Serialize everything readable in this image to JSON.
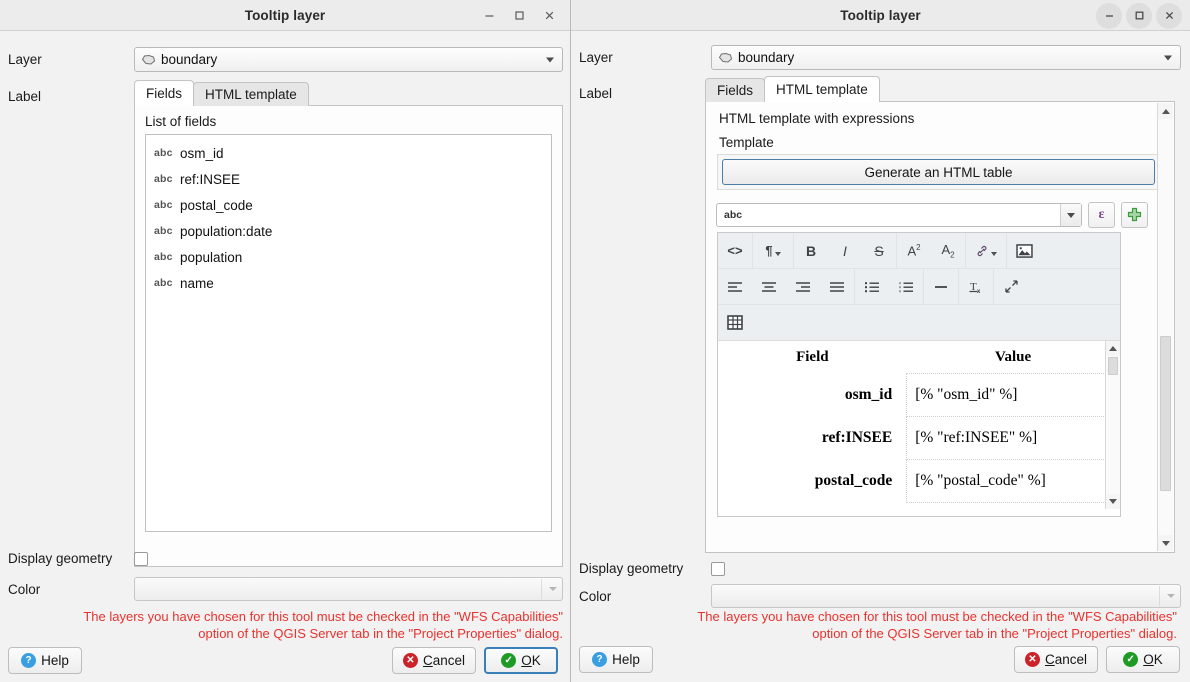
{
  "left_window": {
    "title": "Tooltip layer",
    "window_controls": [
      "minimize",
      "maximize",
      "close"
    ],
    "layer_label": "Layer",
    "layer_value": "boundary",
    "layer_icon": "polygon-layer-icon",
    "label_label": "Label",
    "tabs": [
      {
        "label": "Fields",
        "active": true
      },
      {
        "label": "HTML template",
        "active": false
      }
    ],
    "list_title": "List of fields",
    "field_type_badge": "abc",
    "fields": [
      "osm_id",
      "ref:INSEE",
      "postal_code",
      "population:date",
      "population",
      "name"
    ],
    "display_geometry_label": "Display geometry",
    "display_geometry_checked": false,
    "color_label": "Color",
    "color_value": "",
    "warning_line1": "The layers you have chosen for this tool must be checked in the \"WFS Capabilities\"",
    "warning_line2": "option of the QGIS Server tab in the \"Project Properties\" dialog.",
    "help_label": "Help",
    "cancel_label": "Cancel",
    "ok_label": "OK"
  },
  "right_window": {
    "title": "Tooltip layer",
    "window_controls": [
      "minimize",
      "maximize",
      "close"
    ],
    "layer_label": "Layer",
    "layer_value": "boundary",
    "layer_icon": "polygon-layer-icon",
    "label_label": "Label",
    "tabs": [
      {
        "label": "Fields",
        "active": false
      },
      {
        "label": "HTML template",
        "active": true
      }
    ],
    "panel_title": "HTML template with expressions",
    "template_label": "Template",
    "generate_button": "Generate an HTML table",
    "expression_combo_value": "abc",
    "expression_button": "ε",
    "add_button": "+",
    "toolbar_rows": [
      [
        {
          "name": "source-code-icon",
          "glyph": "<>",
          "has_caret": false
        },
        {
          "name": "paragraph-format-icon",
          "glyph": "¶",
          "has_caret": true
        },
        {
          "name": "bold-icon",
          "glyph": "B",
          "has_caret": false
        },
        {
          "name": "italic-icon",
          "glyph": "I",
          "has_caret": false
        },
        {
          "name": "strikethrough-icon",
          "glyph": "S",
          "has_caret": false
        },
        {
          "name": "superscript-icon",
          "glyph": "A²",
          "has_caret": false
        },
        {
          "name": "subscript-icon",
          "glyph": "A₂",
          "has_caret": false
        },
        {
          "name": "link-icon",
          "glyph": "🔗",
          "has_caret": true
        },
        {
          "name": "insert-image-icon",
          "glyph": "image",
          "has_caret": false
        }
      ],
      [
        {
          "name": "align-left-icon",
          "glyph": "align-left",
          "has_caret": false
        },
        {
          "name": "align-center-icon",
          "glyph": "align-center",
          "has_caret": false
        },
        {
          "name": "align-right-icon",
          "glyph": "align-right",
          "has_caret": false
        },
        {
          "name": "align-justify-icon",
          "glyph": "align-justify",
          "has_caret": false
        },
        {
          "name": "bullet-list-icon",
          "glyph": "bullet-list",
          "has_caret": false
        },
        {
          "name": "numbered-list-icon",
          "glyph": "numbered-list",
          "has_caret": false
        },
        {
          "name": "horizontal-rule-icon",
          "glyph": "—",
          "has_caret": false
        },
        {
          "name": "clear-formatting-icon",
          "glyph": "Tx",
          "has_caret": false
        },
        {
          "name": "fullscreen-icon",
          "glyph": "fullscreen",
          "has_caret": false
        }
      ],
      [
        {
          "name": "insert-table-icon",
          "glyph": "table",
          "has_caret": false
        }
      ]
    ],
    "preview_table": {
      "headers": [
        "Field",
        "Value"
      ],
      "rows": [
        {
          "field": "osm_id",
          "value": "[% \"osm_id\" %]"
        },
        {
          "field": "ref:INSEE",
          "value": "[% \"ref:INSEE\" %]"
        },
        {
          "field": "postal_code",
          "value": "[% \"postal_code\" %]"
        }
      ]
    },
    "display_geometry_label": "Display geometry",
    "display_geometry_checked": false,
    "color_label": "Color",
    "color_value": "",
    "warning_line1": "The layers you have chosen for this tool must be checked in the \"WFS Capabilities\"",
    "warning_line2": "option of the QGIS Server tab in the \"Project Properties\" dialog.",
    "help_label": "Help",
    "cancel_label": "Cancel",
    "ok_label": "OK"
  },
  "colors": {
    "warning_red": "#e8322e",
    "cancel_red": "#cc2229",
    "ok_green": "#1f9b25",
    "help_blue": "#3a9fe0",
    "accent_blue": "#3b7fb8",
    "epsilon_purple": "#7b3f8c",
    "plus_green": "#3e9a3e",
    "window_bg": "#f2f2f2",
    "toolbar_bg": "#eceff1"
  }
}
